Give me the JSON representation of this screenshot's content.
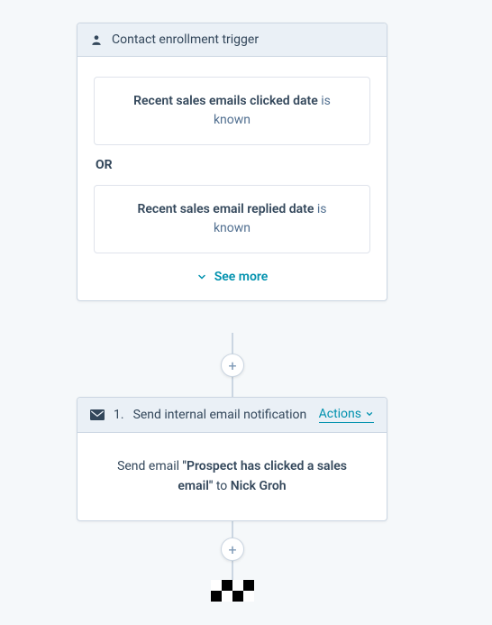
{
  "trigger": {
    "header": "Contact enrollment trigger",
    "criteria": [
      {
        "property": "Recent sales emails clicked date",
        "suffix": "is",
        "value": "known"
      },
      {
        "property": "Recent sales email replied date",
        "suffix": "is",
        "value": "known"
      }
    ],
    "separator": "OR",
    "see_more": "See more"
  },
  "action": {
    "index": "1.",
    "title": "Send internal email notification",
    "actions_label": "Actions",
    "body_prefix": "Send email",
    "email_name": "\"Prospect has clicked a sales email\"",
    "to_word": "to",
    "recipient": "Nick Groh"
  },
  "add_button_1": "+",
  "add_button_2": "+"
}
